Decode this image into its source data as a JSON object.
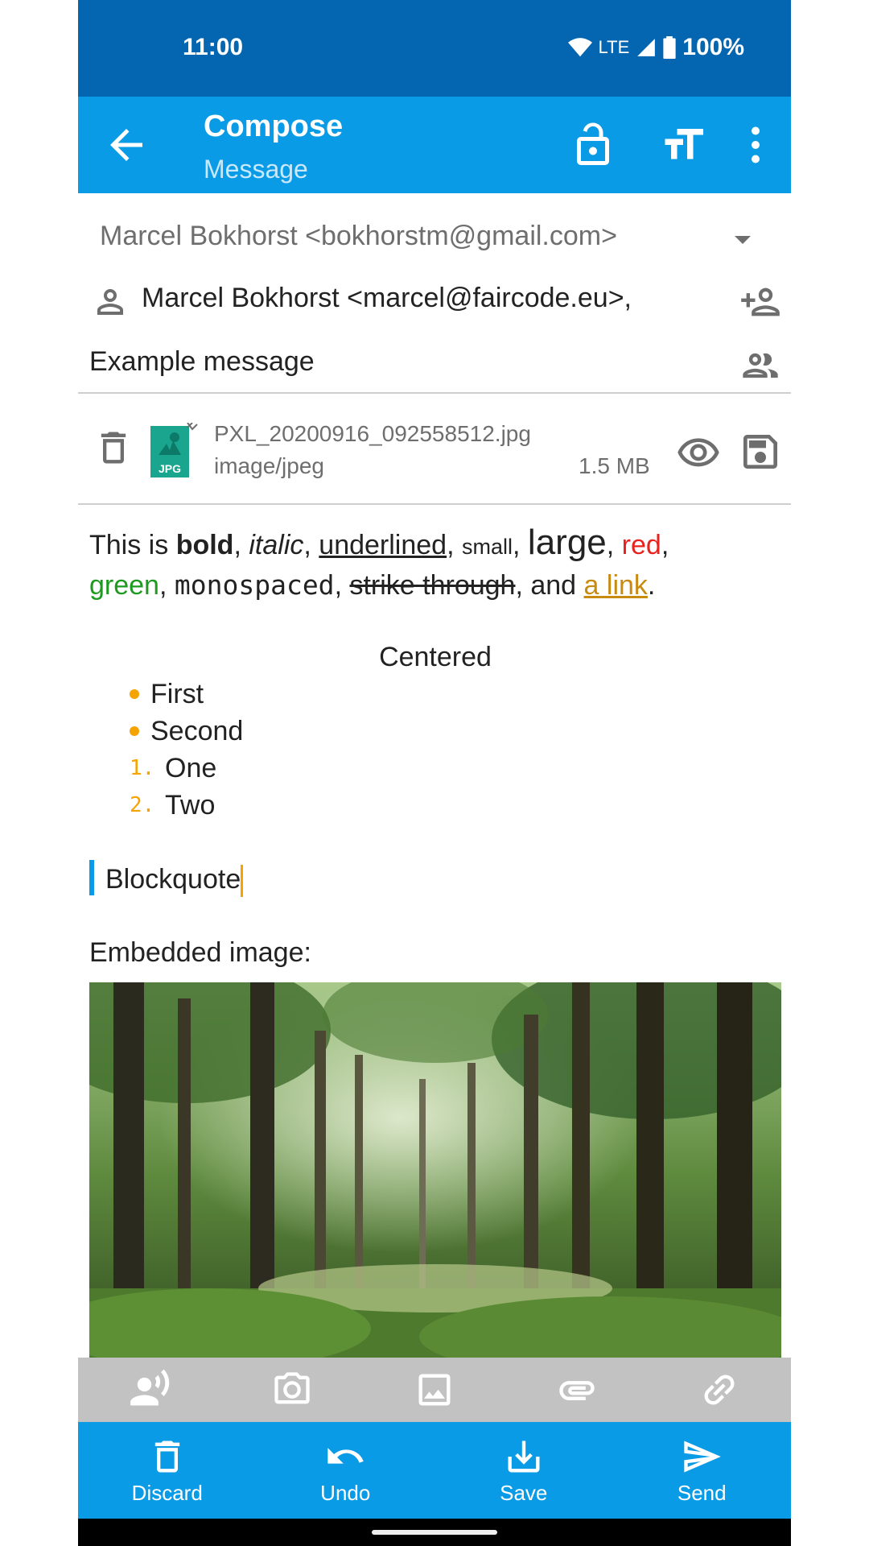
{
  "status_bar": {
    "time": "11:00",
    "network": "LTE",
    "battery": "100%"
  },
  "app_bar": {
    "title": "Compose",
    "subtitle": "Message",
    "icons": [
      "back-arrow-icon",
      "lock-open-icon",
      "text-size-icon",
      "more-vert-icon"
    ]
  },
  "header": {
    "from": "Marcel Bokhorst <bokhorstm@gmail.com>",
    "to": "Marcel Bokhorst <marcel@faircode.eu>,",
    "subject": "Example message"
  },
  "attachment": {
    "filename": "PXL_20200916_092558512.jpg",
    "mime": "image/jpeg",
    "size": "1.5 MB",
    "thumb_label": "JPG"
  },
  "body": {
    "line1": {
      "t1": "This is ",
      "bold": "bold",
      "c1": ", ",
      "italic": "italic",
      "c2": ", ",
      "underlined": "underlined",
      "c3": ", ",
      "small": "small",
      "c4": ", ",
      "large": "large",
      "c5": ", ",
      "red": "red",
      "c6": ","
    },
    "line2": {
      "green": "green",
      "c1": ", ",
      "monospaced": "monospaced",
      "c2": ", ",
      "strike": "strike through",
      "c3": ", and ",
      "link": "a link",
      "c4": "."
    },
    "centered": "Centered",
    "bullets": [
      "First",
      "Second"
    ],
    "numbered": [
      {
        "num": "1.",
        "text": "One"
      },
      {
        "num": "2.",
        "text": "Two"
      }
    ],
    "blockquote": "Blockquote",
    "embedded_label": "Embedded image:"
  },
  "toolbar": {
    "icons": [
      "voice-record-icon",
      "camera-icon",
      "image-icon",
      "attachment-icon",
      "link-icon"
    ]
  },
  "bottom_bar": {
    "discard": "Discard",
    "undo": "Undo",
    "save": "Save",
    "send": "Send"
  },
  "colors": {
    "status_bar": "#0466b0",
    "app_bar": "#0a9be6",
    "accent": "#f5a300",
    "toolbar": "#c2c2c2"
  }
}
